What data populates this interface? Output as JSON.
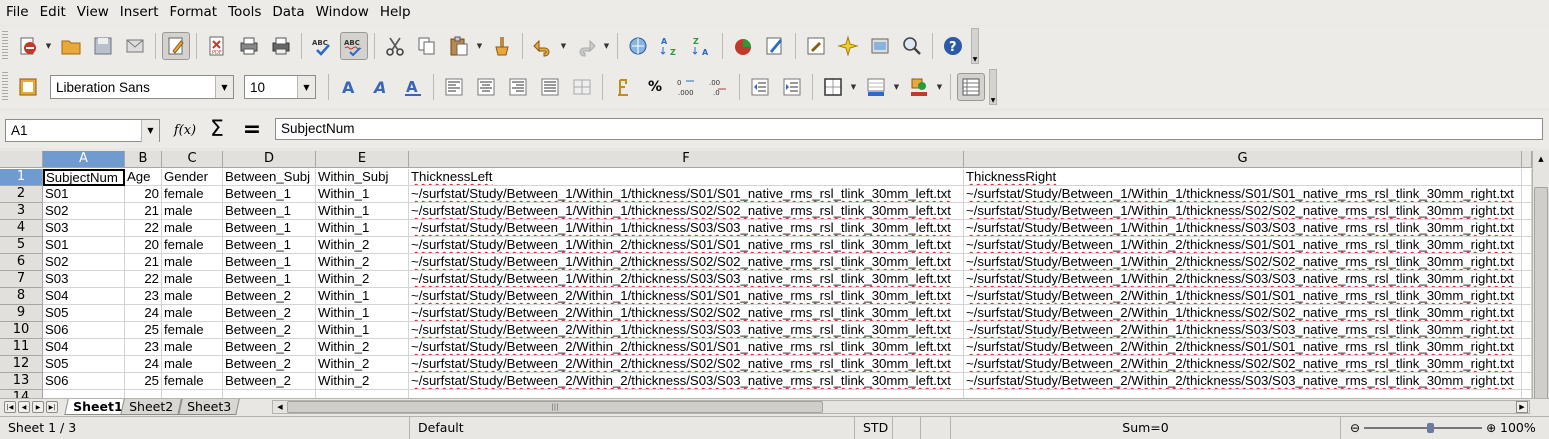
{
  "menu": [
    "File",
    "Edit",
    "View",
    "Insert",
    "Format",
    "Tools",
    "Data",
    "Window",
    "Help"
  ],
  "toolbar_standard": [
    {
      "name": "new-icon"
    },
    {
      "name": "open-icon"
    },
    {
      "name": "save-icon"
    },
    {
      "name": "email-icon"
    },
    {
      "name": "edit-mode-icon"
    },
    {
      "name": "export-pdf-icon"
    },
    {
      "name": "print-icon"
    },
    {
      "name": "print-preview-icon"
    },
    {
      "name": "spellcheck-icon"
    },
    {
      "name": "autospellcheck-icon"
    },
    {
      "name": "cut-icon"
    },
    {
      "name": "copy-icon"
    },
    {
      "name": "paste-icon"
    },
    {
      "name": "clone-format-icon"
    },
    {
      "name": "undo-icon"
    },
    {
      "name": "redo-icon"
    },
    {
      "name": "hyperlink-icon"
    },
    {
      "name": "sort-ascending-icon"
    },
    {
      "name": "sort-descending-icon"
    },
    {
      "name": "chart-icon"
    },
    {
      "name": "show-draw-functions-icon"
    },
    {
      "name": "navigator-icon"
    },
    {
      "name": "gallery-icon"
    },
    {
      "name": "data-sources-icon"
    },
    {
      "name": "zoom-icon"
    },
    {
      "name": "help-icon"
    }
  ],
  "toolbar_format": {
    "font_name": "Liberation Sans",
    "font_size": "10",
    "icons": [
      "bold-icon",
      "italic-icon",
      "underline-icon",
      "align-left-icon",
      "align-center-icon",
      "align-right-icon",
      "justify-icon",
      "merge-cells-icon",
      "currency-icon",
      "percent-icon",
      "add-decimal-icon",
      "delete-decimal-icon",
      "decrease-indent-icon",
      "increase-indent-icon",
      "borders-icon",
      "background-color-icon",
      "font-color-icon",
      "toggle-grid-icon"
    ],
    "percent_label": "%"
  },
  "formula_bar": {
    "name_box": "A1",
    "fx": "f(x)",
    "sum": "Σ",
    "equal": "=",
    "content": "SubjectNum"
  },
  "sheet": {
    "columns": [
      "A",
      "B",
      "C",
      "D",
      "E",
      "F",
      "G"
    ],
    "row_numbers": [
      "1",
      "2",
      "3",
      "4",
      "5",
      "6",
      "7",
      "8",
      "9",
      "10",
      "11",
      "12",
      "13",
      "14"
    ],
    "rows": [
      [
        "SubjectNum",
        "Age",
        "Gender",
        "Between_Subj",
        "Within_Subj",
        "ThicknessLeft",
        "ThicknessRight"
      ],
      [
        "S01",
        "20",
        "female",
        "Between_1",
        "Within_1",
        "~/surfstat/Study/Between_1/Within_1/thickness/S01/S01_native_rms_rsl_tlink_30mm_left.txt",
        "~/surfstat/Study/Between_1/Within_1/thickness/S01/S01_native_rms_rsl_tlink_30mm_right.txt"
      ],
      [
        "S02",
        "21",
        "male",
        "Between_1",
        "Within_1",
        "~/surfstat/Study/Between_1/Within_1/thickness/S02/S02_native_rms_rsl_tlink_30mm_left.txt",
        "~/surfstat/Study/Between_1/Within_1/thickness/S02/S02_native_rms_rsl_tlink_30mm_right.txt"
      ],
      [
        "S03",
        "22",
        "male",
        "Between_1",
        "Within_1",
        "~/surfstat/Study/Between_1/Within_1/thickness/S03/S03_native_rms_rsl_tlink_30mm_left.txt",
        "~/surfstat/Study/Between_1/Within_1/thickness/S03/S03_native_rms_rsl_tlink_30mm_right.txt"
      ],
      [
        "S01",
        "20",
        "female",
        "Between_1",
        "Within_2",
        "~/surfstat/Study/Between_1/Within_2/thickness/S01/S01_native_rms_rsl_tlink_30mm_left.txt",
        "~/surfstat/Study/Between_1/Within_2/thickness/S01/S01_native_rms_rsl_tlink_30mm_right.txt"
      ],
      [
        "S02",
        "21",
        "male",
        "Between_1",
        "Within_2",
        "~/surfstat/Study/Between_1/Within_2/thickness/S02/S02_native_rms_rsl_tlink_30mm_left.txt",
        "~/surfstat/Study/Between_1/Within_2/thickness/S02/S02_native_rms_rsl_tlink_30mm_right.txt"
      ],
      [
        "S03",
        "22",
        "male",
        "Between_1",
        "Within_2",
        "~/surfstat/Study/Between_1/Within_2/thickness/S03/S03_native_rms_rsl_tlink_30mm_left.txt",
        "~/surfstat/Study/Between_1/Within_2/thickness/S03/S03_native_rms_rsl_tlink_30mm_right.txt"
      ],
      [
        "S04",
        "23",
        "male",
        "Between_2",
        "Within_1",
        "~/surfstat/Study/Between_2/Within_1/thickness/S01/S01_native_rms_rsl_tlink_30mm_left.txt",
        "~/surfstat/Study/Between_2/Within_1/thickness/S01/S01_native_rms_rsl_tlink_30mm_right.txt"
      ],
      [
        "S05",
        "24",
        "male",
        "Between_2",
        "Within_1",
        "~/surfstat/Study/Between_2/Within_1/thickness/S02/S02_native_rms_rsl_tlink_30mm_left.txt",
        "~/surfstat/Study/Between_2/Within_1/thickness/S02/S02_native_rms_rsl_tlink_30mm_right.txt"
      ],
      [
        "S06",
        "25",
        "female",
        "Between_2",
        "Within_1",
        "~/surfstat/Study/Between_2/Within_1/thickness/S03/S03_native_rms_rsl_tlink_30mm_left.txt",
        "~/surfstat/Study/Between_2/Within_1/thickness/S03/S03_native_rms_rsl_tlink_30mm_right.txt"
      ],
      [
        "S04",
        "23",
        "male",
        "Between_2",
        "Within_2",
        "~/surfstat/Study/Between_2/Within_2/thickness/S01/S01_native_rms_rsl_tlink_30mm_left.txt",
        "~/surfstat/Study/Between_2/Within_2/thickness/S01/S01_native_rms_rsl_tlink_30mm_right.txt"
      ],
      [
        "S05",
        "24",
        "male",
        "Between_2",
        "Within_2",
        "~/surfstat/Study/Between_2/Within_2/thickness/S02/S02_native_rms_rsl_tlink_30mm_left.txt",
        "~/surfstat/Study/Between_2/Within_2/thickness/S02/S02_native_rms_rsl_tlink_30mm_right.txt"
      ],
      [
        "S06",
        "25",
        "female",
        "Between_2",
        "Within_2",
        "~/surfstat/Study/Between_2/Within_2/thickness/S03/S03_native_rms_rsl_tlink_30mm_left.txt",
        "~/surfstat/Study/Between_2/Within_2/thickness/S03/S03_native_rms_rsl_tlink_30mm_right.txt"
      ]
    ],
    "selected_cell": "A1"
  },
  "tabs": [
    "Sheet1",
    "Sheet2",
    "Sheet3"
  ],
  "active_tab": "Sheet1",
  "status": {
    "sheet": "Sheet 1 / 3",
    "style": "Default",
    "mode": "STD",
    "sum": "Sum=0",
    "zoom": "100%",
    "zoom_minus": "⊖",
    "zoom_plus": "⊕"
  },
  "colors": {
    "selection": "#6f9bd1",
    "spell": "#d02020"
  }
}
